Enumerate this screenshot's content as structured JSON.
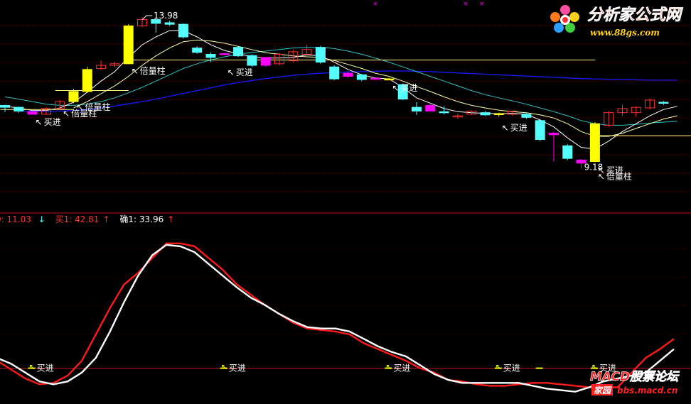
{
  "chart_data": [
    {
      "type": "candlestick",
      "ylim": [
        8.4,
        14.25
      ],
      "colors": {
        "up": "#ff3030",
        "down": "#54ffff",
        "volume_up": "#ffff00",
        "buy_marker": "#ff00ff",
        "ma_short": "#ffffff",
        "ma_mid": "#ffffa0",
        "ma_long": "#2ec4c4",
        "ma_longest": "#1a1aff",
        "ref_line": "#ffff80"
      },
      "candles": [
        {
          "o": 11.18,
          "h": 11.2,
          "l": 10.97,
          "c": 11.12
        },
        {
          "o": 11.12,
          "h": 11.14,
          "l": 10.95,
          "c": 11.0
        },
        {
          "o": 10.98,
          "h": 11.02,
          "l": 10.9,
          "c": 10.9,
          "buy": true
        },
        {
          "o": 10.9,
          "h": 11.12,
          "l": 10.88,
          "c": 11.08
        },
        {
          "o": 11.08,
          "h": 11.35,
          "l": 11.05,
          "c": 11.3
        },
        {
          "o": 11.3,
          "h": 11.7,
          "l": 11.25,
          "c": 11.62,
          "vol": true
        },
        {
          "o": 11.62,
          "h": 12.4,
          "l": 11.58,
          "c": 12.32,
          "vol": true
        },
        {
          "o": 12.35,
          "h": 12.6,
          "l": 12.3,
          "c": 12.45
        },
        {
          "o": 12.45,
          "h": 12.56,
          "l": 12.4,
          "c": 12.5
        },
        {
          "o": 12.5,
          "h": 13.75,
          "l": 12.48,
          "c": 13.7,
          "vol": true
        },
        {
          "o": 13.7,
          "h": 13.98,
          "l": 13.65,
          "c": 13.9
        },
        {
          "o": 13.9,
          "h": 13.95,
          "l": 13.48,
          "c": 13.78
        },
        {
          "o": 13.8,
          "h": 13.86,
          "l": 13.7,
          "c": 13.75
        },
        {
          "o": 13.75,
          "h": 13.78,
          "l": 13.3,
          "c": 13.35
        },
        {
          "o": 13.0,
          "h": 13.05,
          "l": 12.82,
          "c": 12.86
        },
        {
          "o": 12.8,
          "h": 12.86,
          "l": 12.55,
          "c": 12.7
        },
        {
          "o": 12.82,
          "h": 12.85,
          "l": 12.78,
          "c": 12.8,
          "buy": true
        },
        {
          "o": 13.02,
          "h": 13.05,
          "l": 12.72,
          "c": 12.75
        },
        {
          "o": 12.76,
          "h": 12.8,
          "l": 12.4,
          "c": 12.45
        },
        {
          "o": 12.45,
          "h": 12.7,
          "l": 12.4,
          "c": 12.7,
          "buy": true
        },
        {
          "o": 12.5,
          "h": 12.85,
          "l": 12.45,
          "c": 12.8
        },
        {
          "o": 12.6,
          "h": 12.95,
          "l": 12.55,
          "c": 12.88
        },
        {
          "o": 12.8,
          "h": 13.1,
          "l": 12.75,
          "c": 12.95
        },
        {
          "o": 13.02,
          "h": 13.07,
          "l": 12.5,
          "c": 12.55
        },
        {
          "o": 12.4,
          "h": 12.45,
          "l": 11.98,
          "c": 12.02
        },
        {
          "o": 12.2,
          "h": 12.25,
          "l": 12.06,
          "c": 12.1,
          "buy": true
        },
        {
          "o": 12.15,
          "h": 12.18,
          "l": 11.95,
          "c": 12.0
        },
        {
          "o": 12.04,
          "h": 12.06,
          "l": 12.0,
          "c": 12.02,
          "buy": true
        },
        {
          "o": 12.02,
          "h": 12.05,
          "l": 11.98,
          "c": 12.0,
          "vol": true
        },
        {
          "o": 11.84,
          "h": 11.87,
          "l": 11.35,
          "c": 11.38
        },
        {
          "o": 11.12,
          "h": 11.28,
          "l": 10.88,
          "c": 11.0
        },
        {
          "o": 11.0,
          "h": 11.25,
          "l": 10.98,
          "c": 11.18,
          "buy": true
        },
        {
          "o": 10.98,
          "h": 11.15,
          "l": 10.9,
          "c": 10.95
        },
        {
          "o": 10.84,
          "h": 10.92,
          "l": 10.75,
          "c": 10.85
        },
        {
          "o": 10.9,
          "h": 11.02,
          "l": 10.88,
          "c": 11.0
        },
        {
          "o": 10.95,
          "h": 11.0,
          "l": 10.85,
          "c": 10.88
        },
        {
          "o": 10.92,
          "h": 10.95,
          "l": 10.82,
          "c": 10.9,
          "vol": true
        },
        {
          "o": 10.9,
          "h": 11.02,
          "l": 10.85,
          "c": 11.0
        },
        {
          "o": 10.9,
          "h": 10.95,
          "l": 10.75,
          "c": 10.8
        },
        {
          "o": 10.7,
          "h": 10.75,
          "l": 10.05,
          "c": 10.1
        },
        {
          "o": 10.3,
          "h": 10.35,
          "l": 9.4,
          "c": 10.25,
          "buy": true
        },
        {
          "o": 9.9,
          "h": 9.95,
          "l": 9.45,
          "c": 9.5
        },
        {
          "o": 9.45,
          "h": 9.48,
          "l": 9.18,
          "c": 9.35,
          "buy": true
        },
        {
          "o": 9.4,
          "h": 10.65,
          "l": 9.38,
          "c": 10.6,
          "vol": true
        },
        {
          "o": 10.55,
          "h": 11.0,
          "l": 10.5,
          "c": 10.95
        },
        {
          "o": 10.95,
          "h": 11.2,
          "l": 10.85,
          "c": 11.08
        },
        {
          "o": 10.95,
          "h": 11.15,
          "l": 10.82,
          "c": 11.12
        },
        {
          "o": 11.1,
          "h": 11.4,
          "l": 11.05,
          "c": 11.35
        },
        {
          "o": 11.28,
          "h": 11.32,
          "l": 11.2,
          "c": 11.25
        }
      ],
      "ma_short": [
        11.15,
        11.1,
        11.02,
        11.02,
        11.1,
        11.28,
        11.6,
        11.95,
        12.25,
        12.7,
        13.1,
        13.35,
        13.55,
        13.55,
        13.35,
        13.1,
        12.92,
        12.82,
        12.72,
        12.68,
        12.68,
        12.7,
        12.78,
        12.75,
        12.55,
        12.32,
        12.15,
        12.05,
        12.02,
        11.75,
        11.42,
        11.25,
        11.08,
        10.98,
        10.95,
        10.93,
        10.92,
        10.93,
        10.9,
        10.72,
        10.5,
        10.15,
        9.85,
        9.8,
        10.05,
        10.35,
        10.6,
        10.85,
        11.05,
        11.15
      ],
      "ma_mid": [
        null,
        null,
        null,
        null,
        null,
        11.1,
        11.3,
        11.55,
        11.8,
        12.1,
        12.45,
        12.75,
        13.0,
        13.2,
        13.25,
        13.22,
        13.15,
        13.05,
        12.95,
        12.85,
        12.8,
        12.75,
        12.72,
        12.7,
        12.6,
        12.48,
        12.35,
        12.2,
        12.1,
        11.95,
        11.78,
        11.62,
        11.45,
        11.3,
        11.18,
        11.1,
        11.03,
        10.98,
        10.95,
        10.88,
        10.78,
        10.6,
        10.35,
        10.2,
        10.2,
        10.3,
        10.45,
        10.6,
        10.75,
        10.85
      ],
      "ma_long": [
        11.45,
        11.38,
        11.3,
        11.22,
        11.18,
        11.18,
        11.22,
        11.3,
        11.42,
        11.58,
        11.75,
        11.95,
        12.15,
        12.35,
        12.5,
        12.62,
        12.72,
        12.8,
        12.86,
        12.9,
        12.95,
        13.0,
        13.02,
        13.02,
        12.98,
        12.9,
        12.8,
        12.68,
        12.55,
        12.4,
        12.25,
        12.1,
        11.95,
        11.8,
        11.65,
        11.52,
        11.42,
        11.32,
        11.22,
        11.1,
        10.98,
        10.85,
        10.7,
        10.6,
        10.55,
        10.55,
        10.58,
        10.62,
        10.65,
        10.68
      ],
      "ma_longest": [
        null,
        11.0,
        10.99,
        10.99,
        11.0,
        11.02,
        11.05,
        11.1,
        11.16,
        11.23,
        11.3,
        11.38,
        11.47,
        11.56,
        11.65,
        11.74,
        11.83,
        11.9,
        11.97,
        12.03,
        12.08,
        12.13,
        12.17,
        12.2,
        12.22,
        12.24,
        12.25,
        12.26,
        12.27,
        12.27,
        12.26,
        12.25,
        12.23,
        12.21,
        12.19,
        12.17,
        12.15,
        12.13,
        12.11,
        12.09,
        12.07,
        12.05,
        12.03,
        12.02,
        12.01,
        12.0,
        11.99,
        11.98,
        11.98,
        11.98
      ],
      "ref_lines": [
        {
          "start": 9,
          "value": 12.62
        },
        {
          "start": 4,
          "value": 11.65
        },
        {
          "start": 0,
          "value": 11.05
        },
        {
          "start": 43,
          "value": 10.22
        }
      ],
      "high_label": {
        "index": 10,
        "text": "13.98"
      },
      "low_label": {
        "index": 42,
        "text": "9.18"
      },
      "annotations": [
        {
          "index": 2,
          "text": "买进",
          "price": 10.88
        },
        {
          "index": 4,
          "text": "倍量柱",
          "price": 11.15
        },
        {
          "index": 5,
          "text": "倍量柱",
          "price": 11.35
        },
        {
          "index": 9,
          "text": "倍量柱",
          "price": 12.5
        },
        {
          "index": 16,
          "text": "买进",
          "price": 12.45
        },
        {
          "index": 28,
          "text": "买进",
          "price": 11.95
        },
        {
          "index": 36,
          "text": "买进",
          "price": 10.7
        },
        {
          "index": 43,
          "text": "买进",
          "price": 9.35
        },
        {
          "index": 43,
          "text": "倍量柱",
          "price": 9.15
        }
      ]
    },
    {
      "type": "line",
      "title_items": [
        {
          "text": "0: 11.03",
          "arrow": "↓",
          "color": "#ff3030",
          "arrow_color": "#54ffff"
        },
        {
          "text": "买1: 42.81",
          "arrow": "↑",
          "color": "#ff3030",
          "arrow_color": "#ff3030"
        },
        {
          "text": "确1: 33.96",
          "arrow": "↑",
          "color": "#ffffff",
          "arrow_color": "#ff3030"
        }
      ],
      "ylim": [
        -6,
        112
      ],
      "ref_level": 15,
      "series": [
        {
          "color": "#ff1a1a",
          "values": [
            20,
            14,
            8,
            4,
            5,
            10,
            20,
            38,
            56,
            72,
            80,
            90,
            100,
            100,
            98,
            90,
            82,
            72,
            65,
            58,
            52,
            46,
            42,
            41,
            40,
            38,
            32,
            28,
            24,
            20,
            15,
            12,
            7,
            6,
            4,
            3,
            3,
            4,
            5,
            5,
            4,
            3,
            2,
            2,
            2,
            12,
            22,
            28,
            35
          ]
        },
        {
          "color": "#ffffff",
          "values": [
            22,
            18,
            12,
            6,
            4,
            6,
            12,
            22,
            40,
            60,
            78,
            92,
            99,
            98,
            94,
            86,
            78,
            70,
            63,
            58,
            52,
            47,
            43,
            42,
            42,
            40,
            35,
            30,
            26,
            23,
            17,
            11,
            7,
            5,
            5,
            5,
            5,
            5,
            3,
            1,
            0,
            -1,
            2,
            6,
            8,
            10,
            12,
            20,
            28
          ]
        }
      ],
      "annotations": [
        {
          "index": 2,
          "text": "买进"
        },
        {
          "index": 16,
          "text": "买进"
        },
        {
          "index": 28,
          "text": "买进"
        },
        {
          "index": 36,
          "text": "买进"
        },
        {
          "index": 39,
          "text": ""
        },
        {
          "index": 43,
          "text": "买进"
        }
      ]
    }
  ],
  "watermarks": {
    "top_logo_text": "分析家公式网",
    "top_logo_url": "www.88gs.com",
    "bottom_logo_text": "MACD股票论坛",
    "bottom_logo_badge": "家园",
    "bottom_logo_url": "bbs.macd.cn"
  }
}
